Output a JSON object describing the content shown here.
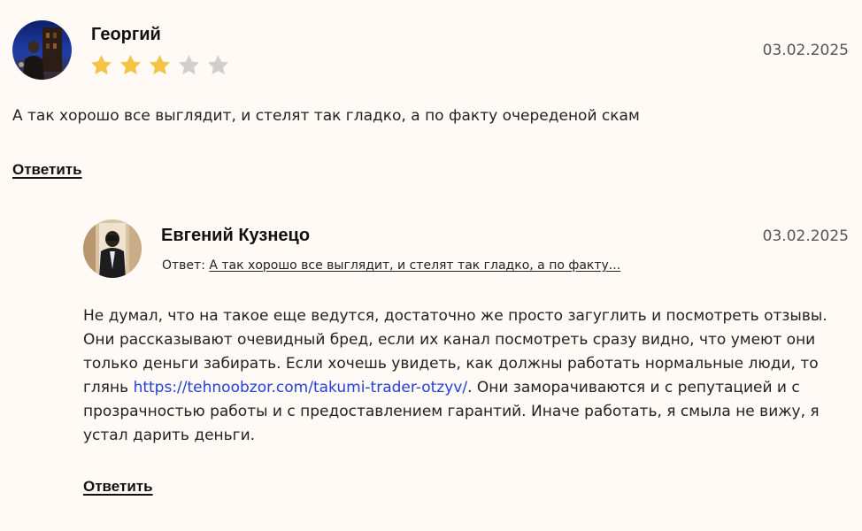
{
  "comment": {
    "author": "Георгий",
    "date": "03.02.2025",
    "rating": 3,
    "rating_max": 5,
    "star_color_filled": "#f6c445",
    "star_color_empty": "#cfcfcf",
    "text": "А так хорошо все выглядит, и стелят так гладко, а по факту очередeной скам",
    "reply_label": "Ответить"
  },
  "reply": {
    "author": "Евгений Кузнецо",
    "date": "03.02.2025",
    "reply_to_prefix": "Ответ:",
    "reply_to_excerpt": "А так хорошо все выглядит, и стелят так гладко, а по факту...",
    "text_before_link": "Не думал, что на такое еще ведутся, достаточно же просто загуглить и посмотреть отзывы. Они рассказывают очевидный бред, если их канал посмотреть сразу видно, что умеют они только деньги забирать. Если хочешь увидеть, как должны работать нормальные люди, то глянь ",
    "link_text": "https://tehnoobzor.com/takumi-trader-otzyv/",
    "text_after_link": ". Они заморачиваются и с репутацией и с прозрачностью работы и с предоставлением гарантий. Иначе работать, я смыла не вижу, я устал дарить деньги.",
    "link_color": "#2340d8",
    "reply_label": "Ответить"
  }
}
